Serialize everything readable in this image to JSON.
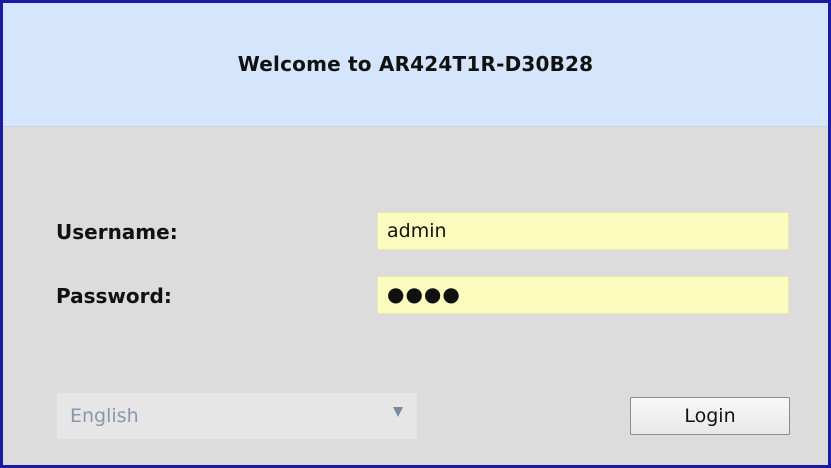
{
  "header": {
    "title": "Welcome to AR424T1R-D30B28"
  },
  "form": {
    "username_label": "Username:",
    "username_value": "admin",
    "password_label": "Password:",
    "password_mask": "●●●●"
  },
  "language": {
    "selected": "English",
    "icon": "chevron-down-icon"
  },
  "actions": {
    "login_label": "Login"
  },
  "colors": {
    "frame_border": "#1a1aa6",
    "header_bg": "#d5e5fb",
    "body_bg": "#dcdcdc",
    "input_bg": "#fcfcbf"
  }
}
